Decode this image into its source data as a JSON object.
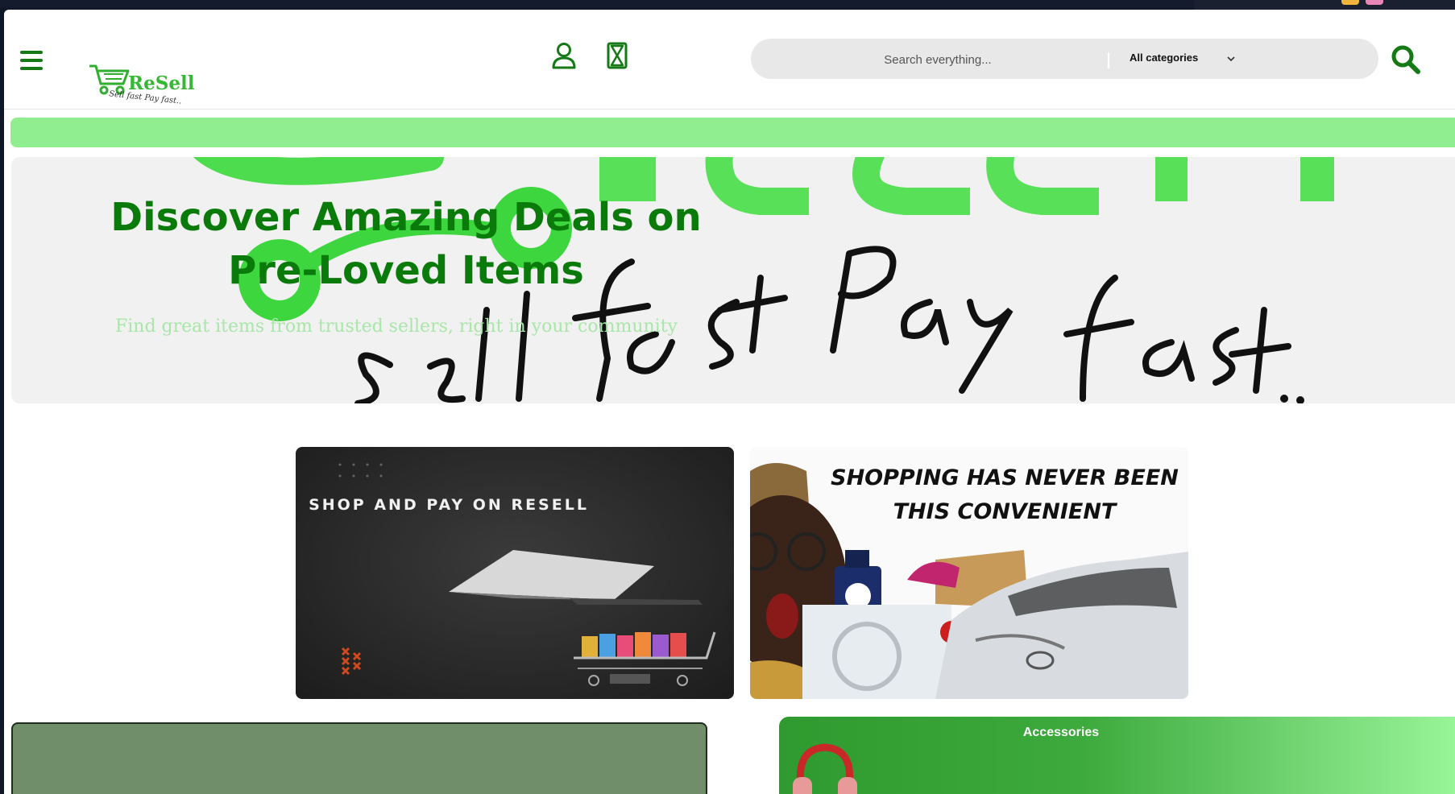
{
  "colors": {
    "brand_green": "#157a15",
    "light_green": "#90ee90",
    "hero_title": "#0a7a0a",
    "hero_subtitle": "#a9e6a9",
    "search_bg": "#e8e8e8"
  },
  "header": {
    "menu_icon": "hamburger-icon",
    "logo": {
      "name": "ReSell",
      "tagline": "Sell fast Pay fast..",
      "icon": "shopping-cart-icon"
    },
    "user_icon": "user-icon",
    "hourglass_icon": "hourglass-icon",
    "search": {
      "placeholder": "Search everything...",
      "category_selected": "All categories",
      "dropdown_icon": "chevron-down-icon",
      "button_icon": "search-icon"
    }
  },
  "hero": {
    "title": "Discover Amazing Deals on Pre-Loved Items",
    "subtitle": "Find great items from trusted sellers, right in your community",
    "background_logo_text": "ReSell",
    "background_tagline": "Sell fast Pay fast.."
  },
  "banners": [
    {
      "text": "SHOP AND PAY ON RESELL"
    },
    {
      "text": "SHOPPING HAS NEVER BEEN THIS CONVENIENT"
    }
  ],
  "categories": {
    "accessories_title": "Accessories",
    "accessories_icon": "headphones-icon"
  }
}
